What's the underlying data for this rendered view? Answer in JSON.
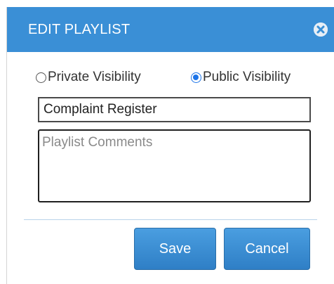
{
  "dialog": {
    "title": "EDIT PLAYLIST",
    "close_icon": "close-icon"
  },
  "visibility": {
    "options": [
      {
        "label": "Private Visibility",
        "checked": false
      },
      {
        "label": "Public Visibility",
        "checked": true
      }
    ]
  },
  "form": {
    "name_value": "Complaint Register",
    "comments_value": "",
    "comments_placeholder": "Playlist Comments"
  },
  "actions": {
    "save_label": "Save",
    "cancel_label": "Cancel"
  },
  "colors": {
    "header": "#3a8fd6",
    "button": "#3a8fd6",
    "radio_checked": "#1a73e8"
  }
}
